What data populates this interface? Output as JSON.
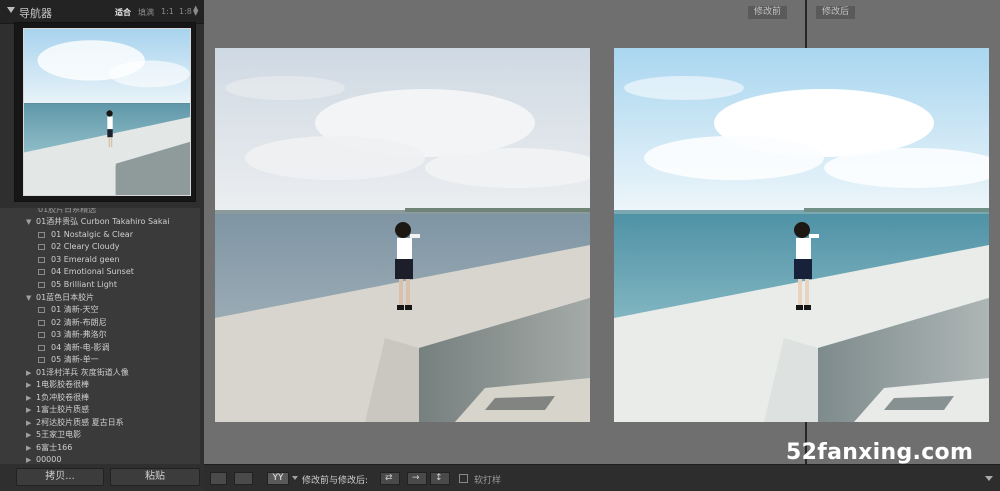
{
  "navigator": {
    "title": "导航器",
    "zoom_options": [
      "适合",
      "填满",
      "1:1",
      "1:8"
    ],
    "selected_zoom": "适合"
  },
  "presets": {
    "partial_top": "01胶片日系精选",
    "folders": [
      {
        "label": "01酒井贵弘 Curbon Takahiro Sakai",
        "expanded": true,
        "items": [
          "01 Nostalgic & Clear",
          "02 Cleary Cloudy",
          "03 Emerald geen",
          "04 Emotional Sunset",
          "05 Brilliant Light"
        ]
      },
      {
        "label": "01蓝色日本胶片",
        "expanded": true,
        "items": [
          "01 清新-天空",
          "02 清新-布朗尼",
          "03 清新-弗洛尔",
          "04 清新-电-影调",
          "05 清新-单一"
        ]
      },
      {
        "label": "01泽村洋兵 灰度街道人像",
        "expanded": false,
        "items": []
      },
      {
        "label": "1电影胶卷很棒",
        "expanded": false,
        "items": []
      },
      {
        "label": "1负冲胶卷很棒",
        "expanded": false,
        "items": []
      },
      {
        "label": "1富士胶片质感",
        "expanded": false,
        "items": []
      },
      {
        "label": "2柯达胶片质感 夏古日系",
        "expanded": false,
        "items": []
      },
      {
        "label": "5王家卫电影",
        "expanded": false,
        "items": []
      },
      {
        "label": "6富士166",
        "expanded": false,
        "items": []
      },
      {
        "label": "00000",
        "expanded": false,
        "items": []
      }
    ]
  },
  "buttons": {
    "copy": "拷贝...",
    "paste": "粘贴"
  },
  "compare": {
    "before_label": "修改前",
    "after_label": "修改后"
  },
  "toolbar": {
    "view_ab": "YY",
    "compare_label": "修改前与修改后:",
    "softproof_label": "软打样"
  },
  "watermark": "52fanxing.com",
  "colors": {
    "panel_bg": "#2f2f2f",
    "preset_bg": "#3a3a3a",
    "main_bg": "#6f6f6f",
    "toolbar_bg": "#2d2d2d"
  }
}
